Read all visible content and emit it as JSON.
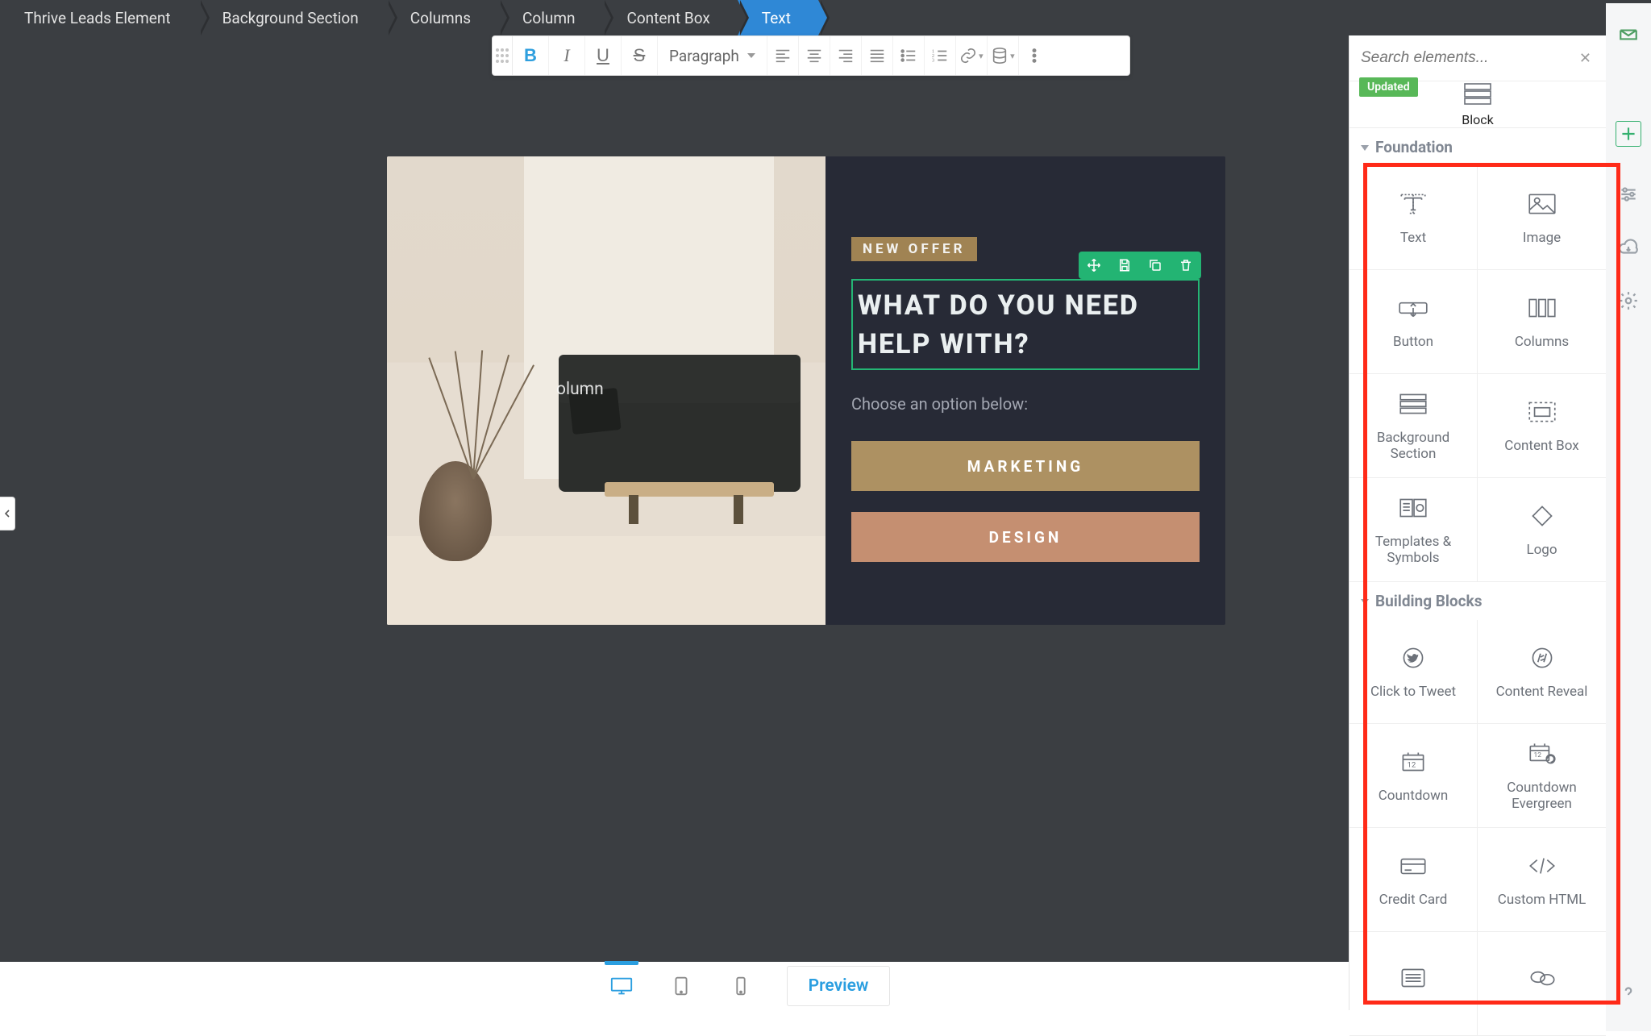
{
  "breadcrumbs": [
    "Thrive Leads Element",
    "Background Section",
    "Columns",
    "Column",
    "Content Box",
    "Text"
  ],
  "toolbar": {
    "block_type": "Paragraph"
  },
  "canvas": {
    "ghost_label": "olumn",
    "badge": "NEW OFFER",
    "headline": "WHAT DO YOU NEED HELP WITH?",
    "subtext": "Choose an option below:",
    "button_a": "MARKETING",
    "button_b": "DESIGN"
  },
  "bottom": {
    "preview": "Preview"
  },
  "panel": {
    "search_placeholder": "Search elements...",
    "updated_badge": "Updated",
    "block_label": "Block",
    "sections": {
      "foundation": {
        "title": "Foundation",
        "items": [
          "Text",
          "Image",
          "Button",
          "Columns",
          "Background Section",
          "Content Box",
          "Templates & Symbols",
          "Logo"
        ]
      },
      "building": {
        "title": "Building Blocks",
        "items": [
          "Click to Tweet",
          "Content Reveal",
          "Countdown",
          "Countdown Evergreen",
          "Credit Card",
          "Custom HTML"
        ]
      }
    }
  }
}
